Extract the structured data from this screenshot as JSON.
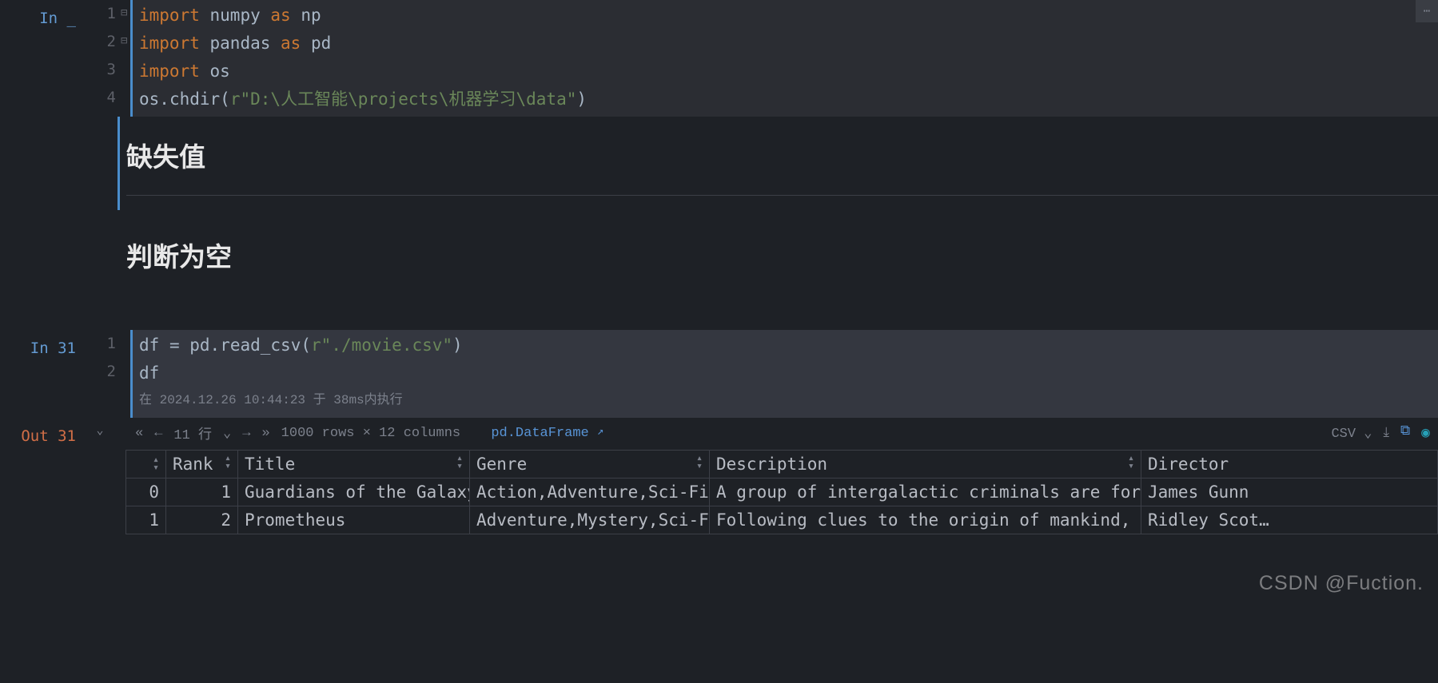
{
  "cell1": {
    "prompt_label": "In",
    "prompt_num": "_",
    "lines": [
      "1",
      "2",
      "3",
      "4"
    ],
    "fold": [
      "⊟",
      "",
      "⊟",
      ""
    ],
    "code": {
      "l1_import": "import",
      "l1_mod": "numpy",
      "l1_as": "as",
      "l1_alias": "np",
      "l2_import": "import",
      "l2_mod": "pandas",
      "l2_as": "as",
      "l2_alias": "pd",
      "l3_import": "import",
      "l3_mod": "os",
      "l4_obj": "os",
      "l4_dot": ".",
      "l4_fn": "chdir",
      "l4_open": "(",
      "l4_pfx": "r",
      "l4_q1": "\"",
      "l4_str": "D:\\人工智能\\projects\\机器学习\\data",
      "l4_q2": "\"",
      "l4_close": ")"
    }
  },
  "md1": {
    "heading": "缺失值"
  },
  "md2": {
    "heading": "判断为空"
  },
  "cell2": {
    "prompt_label": "In",
    "prompt_num": "31",
    "lines": [
      "1",
      "2"
    ],
    "code": {
      "l1_var": "df",
      "l1_eq": " = ",
      "l1_obj": "pd",
      "l1_dot": ".",
      "l1_fn": "read_csv",
      "l1_open": "(",
      "l1_pfx": "r",
      "l1_q1": "\"",
      "l1_str": "./movie.csv",
      "l1_q2": "\"",
      "l1_close": ")",
      "l2": "df"
    },
    "exec_meta": "在 2024.12.26 10:44:23 于 38ms内执行"
  },
  "out": {
    "prompt_label": "Out",
    "prompt_num": "31",
    "nav_rows": "11 行",
    "rows_info": "1000 rows × 12 columns",
    "df_type": "pd.DataFrame",
    "csv_label": "CSV",
    "table": {
      "columns": [
        "",
        "Rank",
        "Title",
        "Genre",
        "Description",
        "Director"
      ],
      "rows": [
        {
          "idx": "0",
          "Rank": "1",
          "Title": "Guardians of the Galaxy",
          "Genre": "Action,Adventure,Sci-Fi",
          "Description": "A group of intergalactic criminals are forc…",
          "Director": "James Gunn"
        },
        {
          "idx": "1",
          "Rank": "2",
          "Title": "Prometheus",
          "Genre": "Adventure,Mystery,Sci-Fi",
          "Description": "Following clues to the origin of mankind, a…",
          "Director": "Ridley Scot…"
        }
      ]
    }
  },
  "watermark": "CSDN @Fuction."
}
